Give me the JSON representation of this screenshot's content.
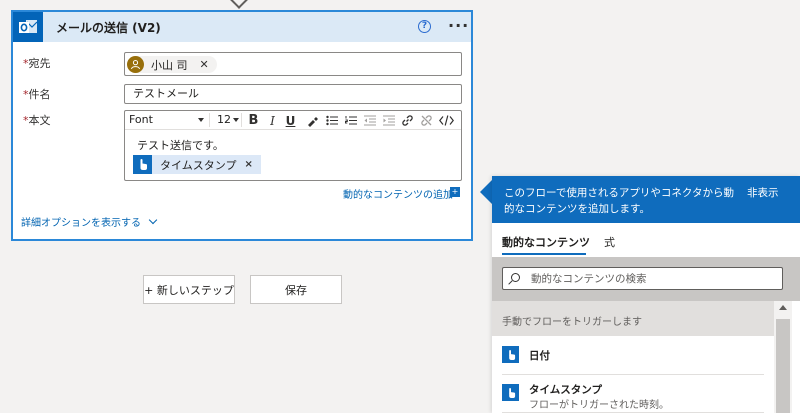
{
  "card": {
    "title": "メールの送信 (V2)",
    "help": "?",
    "more": "···",
    "to_label": "宛先",
    "required_mark": "*",
    "subject_label": "件名",
    "body_label": "本文",
    "recipient_name": "小山 司",
    "remove": "✕",
    "subject_value": "テストメール",
    "toolbar": {
      "font": "Font",
      "size": "12"
    },
    "body_text": "テスト送信です。",
    "token_label": "タイムスタンプ",
    "token_remove": "×",
    "add_dynamic": "動的なコンテンツの追加",
    "add_dynamic_plus": "+",
    "show_advanced": "詳細オプションを表示する"
  },
  "buttons": {
    "new_step": "+ 新しいステップ",
    "save": "保存"
  },
  "panel": {
    "banner_text": "このフローで使用されるアプリやコネクタから動的なコンテンツを追加します。",
    "hide": "非表示",
    "tabs": [
      "動的なコンテンツ",
      "式"
    ],
    "search_placeholder": "動的なコンテンツの検索",
    "section": "手動でフローをトリガーします",
    "items": [
      {
        "title": "日付",
        "subtitle": ""
      },
      {
        "title": "タイムスタンプ",
        "subtitle": "フローがトリガーされた時刻。"
      }
    ]
  },
  "colors": {
    "accent": "#0f6cbd",
    "link": "#0063b1",
    "header": "#dbe9f6",
    "required": "#a4262c"
  },
  "icons": [
    "outlook-icon",
    "help-icon",
    "more-icon",
    "person-icon",
    "close-icon",
    "bold-icon",
    "italic-icon",
    "underline-icon",
    "highlighter-icon",
    "bulleted-list-icon",
    "numbered-list-icon",
    "decrease-indent-icon",
    "increase-indent-icon",
    "link-icon",
    "unlink-icon",
    "code-icon",
    "touch-icon",
    "chevron-down-icon",
    "search-icon"
  ]
}
